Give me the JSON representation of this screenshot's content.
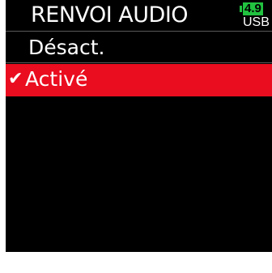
{
  "header": {
    "title": "RENVOI AUDIO",
    "battery": {
      "level": "4.9",
      "source": "USB",
      "color": "#21c23f"
    }
  },
  "menu": {
    "items": [
      {
        "label": "Désact.",
        "selected": false
      },
      {
        "label": "Activé",
        "selected": true,
        "check_icon": "✔"
      }
    ],
    "selection_color": "#ea0d1f"
  }
}
